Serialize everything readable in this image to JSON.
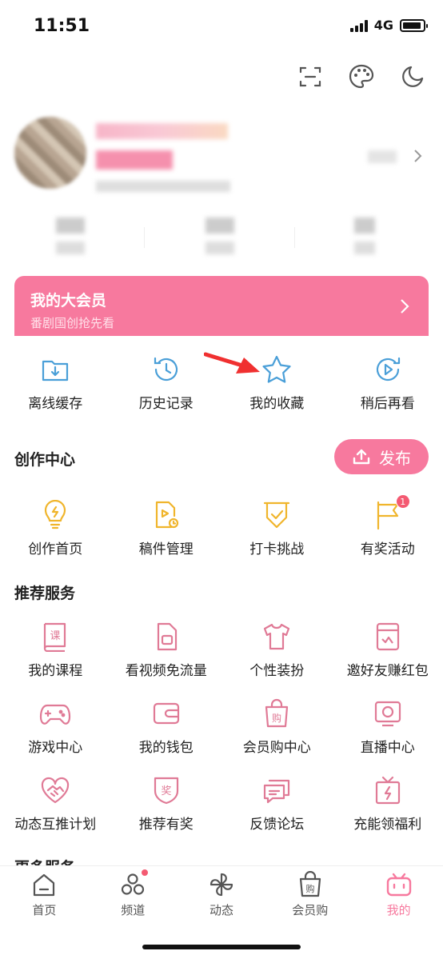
{
  "status_bar": {
    "time": "11:51",
    "network": "4G",
    "battery_level": 0.92
  },
  "vip_banner": {
    "title": "我的大会员",
    "subtitle": "番剧国创抢先看"
  },
  "quick_actions": [
    {
      "label": "离线缓存",
      "icon": "download-folder-icon"
    },
    {
      "label": "历史记录",
      "icon": "history-clock-icon"
    },
    {
      "label": "我的收藏",
      "icon": "star-icon"
    },
    {
      "label": "稍后再看",
      "icon": "watch-later-icon"
    }
  ],
  "creation_center": {
    "title": "创作中心",
    "publish_label": "发布",
    "items": [
      {
        "label": "创作首页",
        "icon": "lightbulb-icon"
      },
      {
        "label": "稿件管理",
        "icon": "manuscript-icon"
      },
      {
        "label": "打卡挑战",
        "icon": "checkin-badge-icon"
      },
      {
        "label": "有奖活动",
        "icon": "flag-icon",
        "badge": "1"
      }
    ]
  },
  "recommended_services": {
    "title": "推荐服务",
    "items": [
      {
        "label": "我的课程",
        "icon": "course-book-icon"
      },
      {
        "label": "看视频免流量",
        "icon": "sim-card-icon"
      },
      {
        "label": "个性装扮",
        "icon": "tshirt-icon"
      },
      {
        "label": "邀好友赚红包",
        "icon": "red-packet-icon"
      },
      {
        "label": "游戏中心",
        "icon": "gamepad-icon"
      },
      {
        "label": "我的钱包",
        "icon": "wallet-icon"
      },
      {
        "label": "会员购中心",
        "icon": "shopping-bag-icon"
      },
      {
        "label": "直播中心",
        "icon": "live-tv-icon"
      },
      {
        "label": "动态互推计划",
        "icon": "heart-handshake-icon"
      },
      {
        "label": "推荐有奖",
        "icon": "reward-badge-icon"
      },
      {
        "label": "反馈论坛",
        "icon": "chat-bubbles-icon"
      },
      {
        "label": "充能领福利",
        "icon": "gift-box-icon"
      }
    ]
  },
  "partial_section_title": "更多服务",
  "tabbar": [
    {
      "label": "首页",
      "icon": "home-icon"
    },
    {
      "label": "频道",
      "icon": "channels-icon"
    },
    {
      "label": "动态",
      "icon": "pinwheel-icon"
    },
    {
      "label": "会员购",
      "icon": "shopping-bag-icon"
    },
    {
      "label": "我的",
      "icon": "tv-mascot-icon",
      "active": true
    }
  ],
  "colors": {
    "accent": "#f7799e",
    "badge": "#f45a72",
    "icon_blue": "#4a9fd8",
    "icon_yellow": "#f0b52c"
  }
}
